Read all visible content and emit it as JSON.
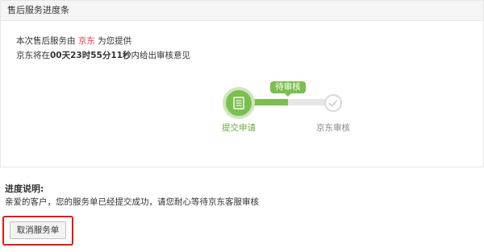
{
  "panel": {
    "title": "售后服务进度条"
  },
  "info": {
    "line1_prefix": "本次售后服务由 ",
    "provider": "京东",
    "line1_suffix": " 为您提供",
    "line2_prefix": "京东将在",
    "days": "00天",
    "hours": "23时",
    "minutes": "55分",
    "seconds": "11秒",
    "line2_suffix": "内给出审核意见"
  },
  "progress": {
    "current_status": "待审核",
    "step1_label": "提交申请",
    "step2_label": "京东审核"
  },
  "description": {
    "title": "进度说明:",
    "text": "亲爱的客户，您的服务单已经提交成功，请您耐心等待京东客服审核"
  },
  "actions": {
    "cancel_label": "取消服务单"
  },
  "colors": {
    "accent_green": "#7bbf4e",
    "highlight_red": "#e4393c",
    "annotation_red": "#e8171b"
  }
}
